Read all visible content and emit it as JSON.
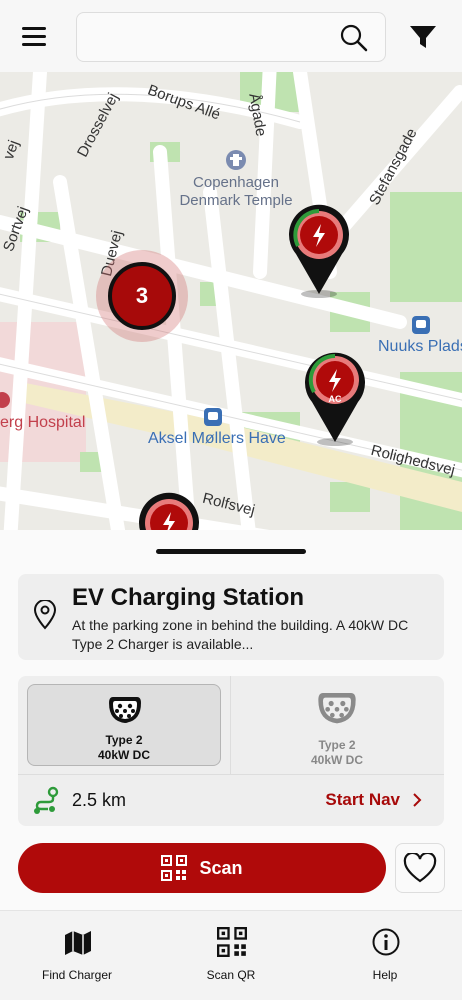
{
  "header": {
    "search_placeholder": "",
    "menu_icon": "hamburger-icon",
    "search_icon": "search-icon",
    "filter_icon": "filter-icon"
  },
  "map": {
    "streets": [
      "Borups Allé",
      "Ågade",
      "Drosselvej",
      "Stefansgade",
      "Duevej",
      "Rolighedsvej",
      "Rolfsvej",
      "Sortvej",
      "vej"
    ],
    "pois": [
      "Copenhagen Denmark Temple",
      "Nuuks Plads",
      "Aksel Møllers Have",
      "erg Hospital"
    ],
    "cluster_count": "3",
    "pin_ac_label": "AC"
  },
  "station": {
    "title": "EV Charging Station",
    "description": "At the parking zone in behind the building. A 40kW DC Type 2 Charger is available..."
  },
  "connectors": [
    {
      "type": "Type 2",
      "power": "40kW DC",
      "selected": true
    },
    {
      "type": "Type 2",
      "power": "40kW DC",
      "selected": false
    }
  ],
  "route": {
    "distance": "2.5 km",
    "start_nav_label": "Start Nav"
  },
  "actions": {
    "scan_label": "Scan"
  },
  "bottom_nav": {
    "items": [
      {
        "label": "Find Charger",
        "icon": "map-icon"
      },
      {
        "label": "Scan QR",
        "icon": "qr-icon"
      },
      {
        "label": "Help",
        "icon": "info-icon"
      }
    ]
  },
  "colors": {
    "brand_red": "#b00a0a",
    "route_green": "#2e9b3a",
    "map_green": "#bfe3b0",
    "map_road": "#ffffff"
  }
}
